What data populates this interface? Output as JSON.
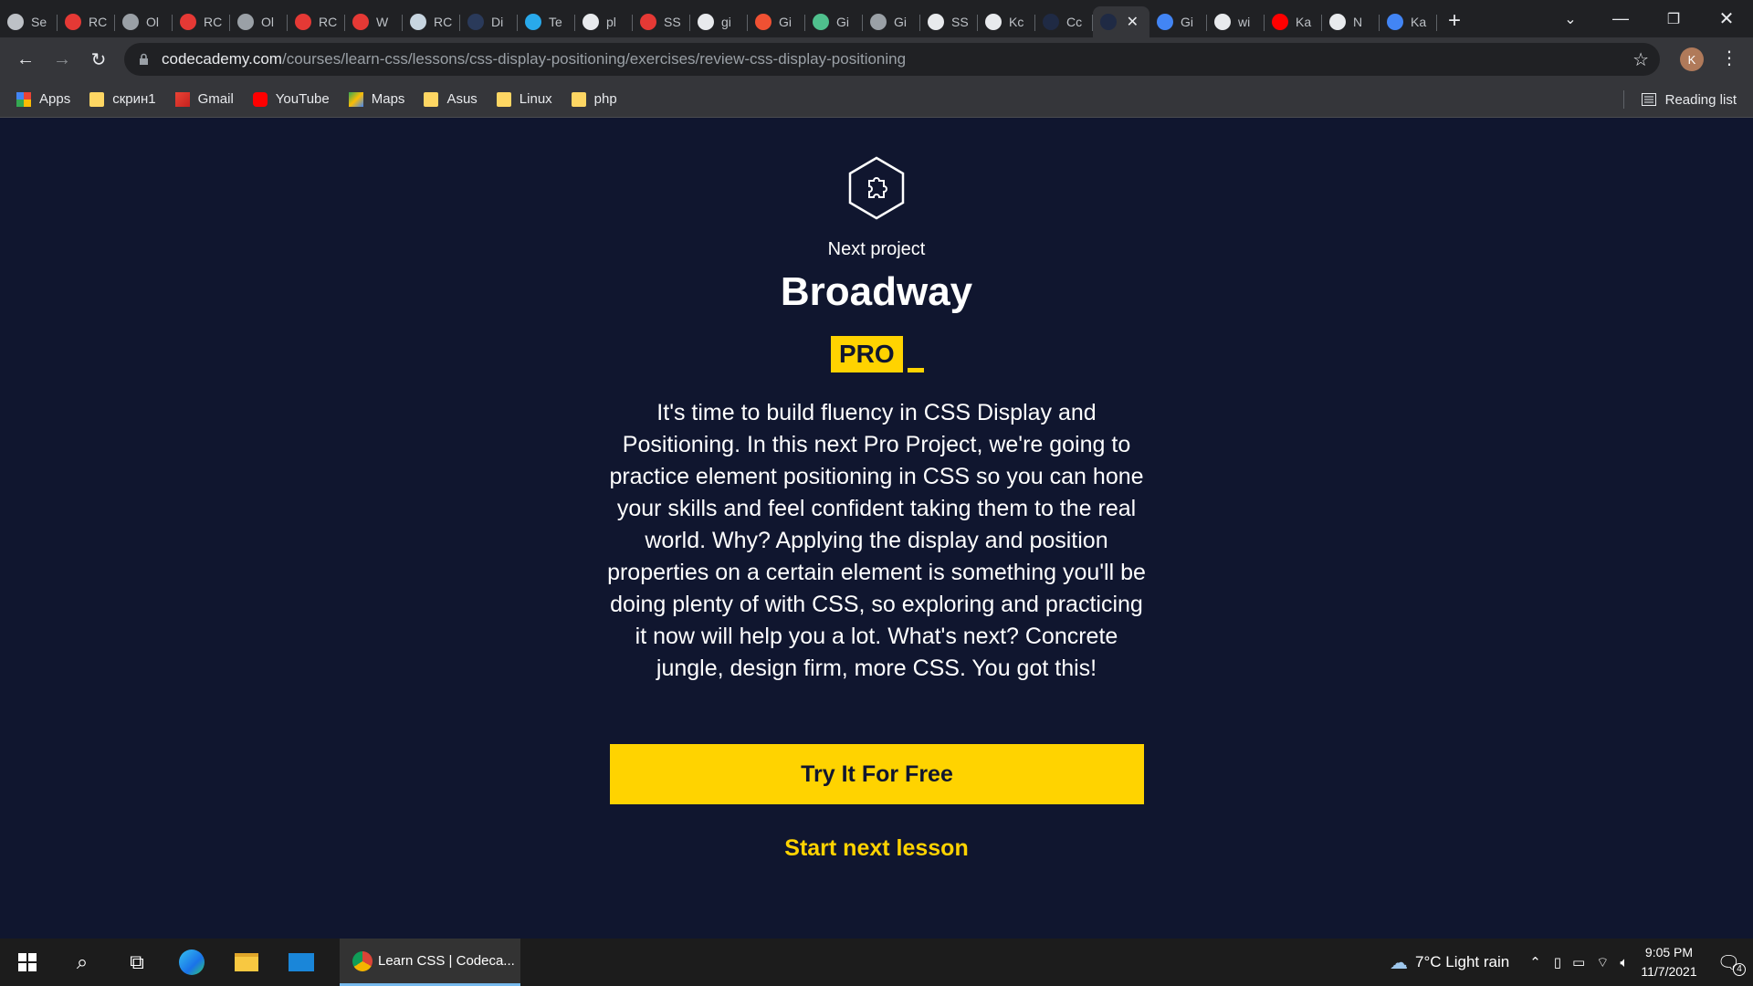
{
  "browser": {
    "tabs": [
      {
        "label": "Se",
        "icon": "gear-icon",
        "color": "#bdc1c6"
      },
      {
        "label": "RC",
        "icon": "rog-icon",
        "color": "#e53935"
      },
      {
        "label": "Ol",
        "icon": "globe-icon",
        "color": "#9aa0a6"
      },
      {
        "label": "RC",
        "icon": "rog-icon",
        "color": "#e53935"
      },
      {
        "label": "Ol",
        "icon": "globe-icon",
        "color": "#9aa0a6"
      },
      {
        "label": "RC",
        "icon": "rog-icon",
        "color": "#e53935"
      },
      {
        "label": "W",
        "icon": "rog-icon",
        "color": "#e53935"
      },
      {
        "label": "RC",
        "icon": "steam-icon",
        "color": "#c7d5e0"
      },
      {
        "label": "Di",
        "icon": "dot-icon",
        "color": "#2a3a5a"
      },
      {
        "label": "Te",
        "icon": "telegram-icon",
        "color": "#29a9eb"
      },
      {
        "label": "pl",
        "icon": "github-icon",
        "color": "#e8eaed"
      },
      {
        "label": "SS",
        "icon": "stop-icon",
        "color": "#e53935"
      },
      {
        "label": "gi",
        "icon": "google-icon",
        "color": "#e8eaed"
      },
      {
        "label": "Gi",
        "icon": "git-icon",
        "color": "#f05133"
      },
      {
        "label": "Gi",
        "icon": "gitkraken-icon",
        "color": "#4fc08d"
      },
      {
        "label": "Gi",
        "icon": "globe-icon",
        "color": "#9aa0a6"
      },
      {
        "label": "SS",
        "icon": "github-icon",
        "color": "#e8eaed"
      },
      {
        "label": "Kc",
        "icon": "github-icon",
        "color": "#e8eaed"
      },
      {
        "label": "Cc",
        "icon": "square-icon",
        "color": "#1f2a44"
      },
      {
        "label": "",
        "icon": "codecademy-icon",
        "color": "#1f2a44",
        "active": true
      },
      {
        "label": "Gi",
        "icon": "translate-icon",
        "color": "#4285f4"
      },
      {
        "label": "wi",
        "icon": "google-icon",
        "color": "#e8eaed"
      },
      {
        "label": "Ka",
        "icon": "youtube-icon",
        "color": "#ff0000"
      },
      {
        "label": "N",
        "icon": "openai-icon",
        "color": "#e8eaed"
      },
      {
        "label": "Ka",
        "icon": "google-icon",
        "color": "#4285f4"
      }
    ],
    "url_host": "codecademy.com",
    "url_path": "/courses/learn-css/lessons/css-display-positioning/exercises/review-css-display-positioning",
    "profile_initial": "K",
    "bookmarks": [
      {
        "label": "Apps",
        "icon": "apps-grid-icon"
      },
      {
        "label": "скрин1",
        "icon": "folder-icon"
      },
      {
        "label": "Gmail",
        "icon": "gmail-icon"
      },
      {
        "label": "YouTube",
        "icon": "youtube-icon"
      },
      {
        "label": "Maps",
        "icon": "maps-icon"
      },
      {
        "label": "Asus",
        "icon": "folder-icon"
      },
      {
        "label": "Linux",
        "icon": "folder-icon"
      },
      {
        "label": "php",
        "icon": "folder-icon"
      }
    ],
    "reading_list": "Reading list"
  },
  "page": {
    "next_label": "Next project",
    "title": "Broadway",
    "badge": "PRO",
    "description": "It's time to build fluency in CSS Display and Positioning. In this next Pro Project, we're going to practice element positioning in CSS so you can hone your skills and feel confident taking them to the real world. Why? Applying the display and position properties on a certain element is something you'll be doing plenty of with CSS, so exploring and practicing it now will help you a lot. What's next? Concrete jungle, design firm, more CSS. You got this!",
    "try_button": "Try It For Free",
    "start_next": "Start next lesson",
    "accent_color": "#ffd300",
    "background_color": "#10162f"
  },
  "taskbar": {
    "app_label": "Learn CSS | Codeca...",
    "weather": "7°C  Light rain",
    "time": "9:05 PM",
    "date": "11/7/2021",
    "notifications": "4"
  }
}
